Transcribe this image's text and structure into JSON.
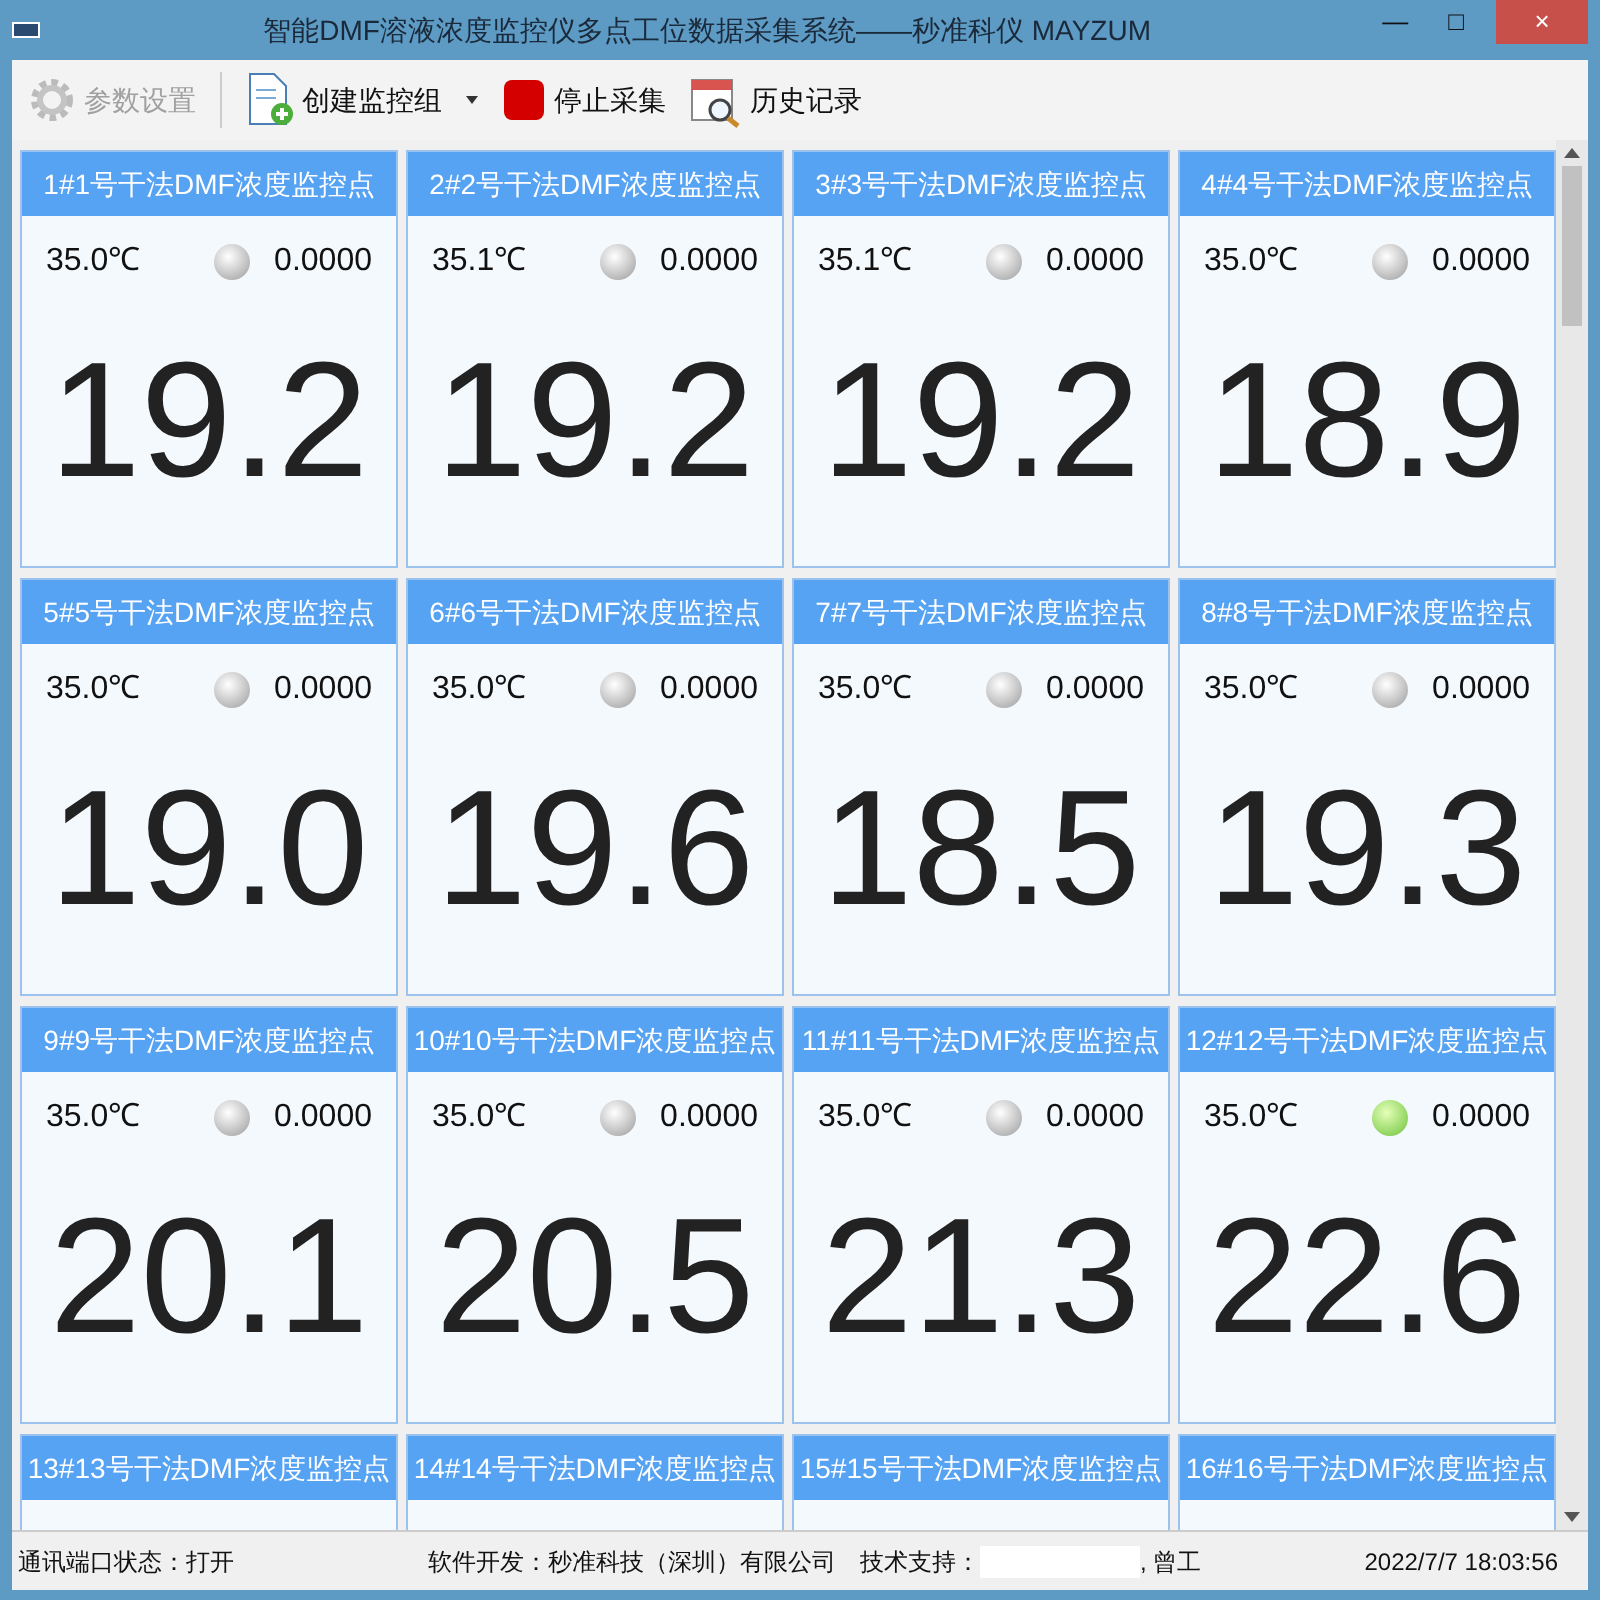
{
  "window": {
    "title": "智能DMF溶液浓度监控仪多点工位数据采集系统——秒准科仪 MAYZUM",
    "controls": [
      "—",
      "□",
      "×"
    ]
  },
  "toolbar": [
    {
      "label": "参数设置",
      "disabled": true,
      "dropdown": false
    },
    {
      "label": "创建监控组",
      "disabled": false,
      "dropdown": true
    },
    {
      "label": "停止采集",
      "disabled": false,
      "dropdown": false
    },
    {
      "label": "历史记录",
      "disabled": false,
      "dropdown": false
    }
  ],
  "cards": [
    {
      "title": "1#1号干法DMF浓度监控点",
      "temperature": "35.0℃",
      "lit": false,
      "reading": "0.0000",
      "value": "19.2"
    },
    {
      "title": "2#2号干法DMF浓度监控点",
      "temperature": "35.1℃",
      "lit": false,
      "reading": "0.0000",
      "value": "19.2"
    },
    {
      "title": "3#3号干法DMF浓度监控点",
      "temperature": "35.1℃",
      "lit": false,
      "reading": "0.0000",
      "value": "19.2"
    },
    {
      "title": "4#4号干法DMF浓度监控点",
      "temperature": "35.0℃",
      "lit": false,
      "reading": "0.0000",
      "value": "18.9"
    },
    {
      "title": "5#5号干法DMF浓度监控点",
      "temperature": "35.0℃",
      "lit": false,
      "reading": "0.0000",
      "value": "19.0"
    },
    {
      "title": "6#6号干法DMF浓度监控点",
      "temperature": "35.0℃",
      "lit": false,
      "reading": "0.0000",
      "value": "19.6"
    },
    {
      "title": "7#7号干法DMF浓度监控点",
      "temperature": "35.0℃",
      "lit": false,
      "reading": "0.0000",
      "value": "18.5"
    },
    {
      "title": "8#8号干法DMF浓度监控点",
      "temperature": "35.0℃",
      "lit": false,
      "reading": "0.0000",
      "value": "19.3"
    },
    {
      "title": "9#9号干法DMF浓度监控点",
      "temperature": "35.0℃",
      "lit": false,
      "reading": "0.0000",
      "value": "20.1"
    },
    {
      "title": "10#10号干法DMF浓度监控点",
      "temperature": "35.0℃",
      "lit": false,
      "reading": "0.0000",
      "value": "20.5"
    },
    {
      "title": "11#11号干法DMF浓度监控点",
      "temperature": "35.0℃",
      "lit": false,
      "reading": "0.0000",
      "value": "21.3"
    },
    {
      "title": "12#12号干法DMF浓度监控点",
      "temperature": "35.0℃",
      "lit": true,
      "reading": "0.0000",
      "value": "22.6"
    },
    {
      "title": "13#13号干法DMF浓度监控点"
    },
    {
      "title": "14#14号干法DMF浓度监控点"
    },
    {
      "title": "15#15号干法DMF浓度监控点"
    },
    {
      "title": "16#16号干法DMF浓度监控点"
    }
  ],
  "status_bar": {
    "port_status": "通讯端口状态：打开",
    "developer": "软件开发：秒准科技（深圳）有限公司",
    "support_label": "技术支持：",
    "support_contact": ", 曾工",
    "datetime": "2022/7/7 18:03:56"
  }
}
